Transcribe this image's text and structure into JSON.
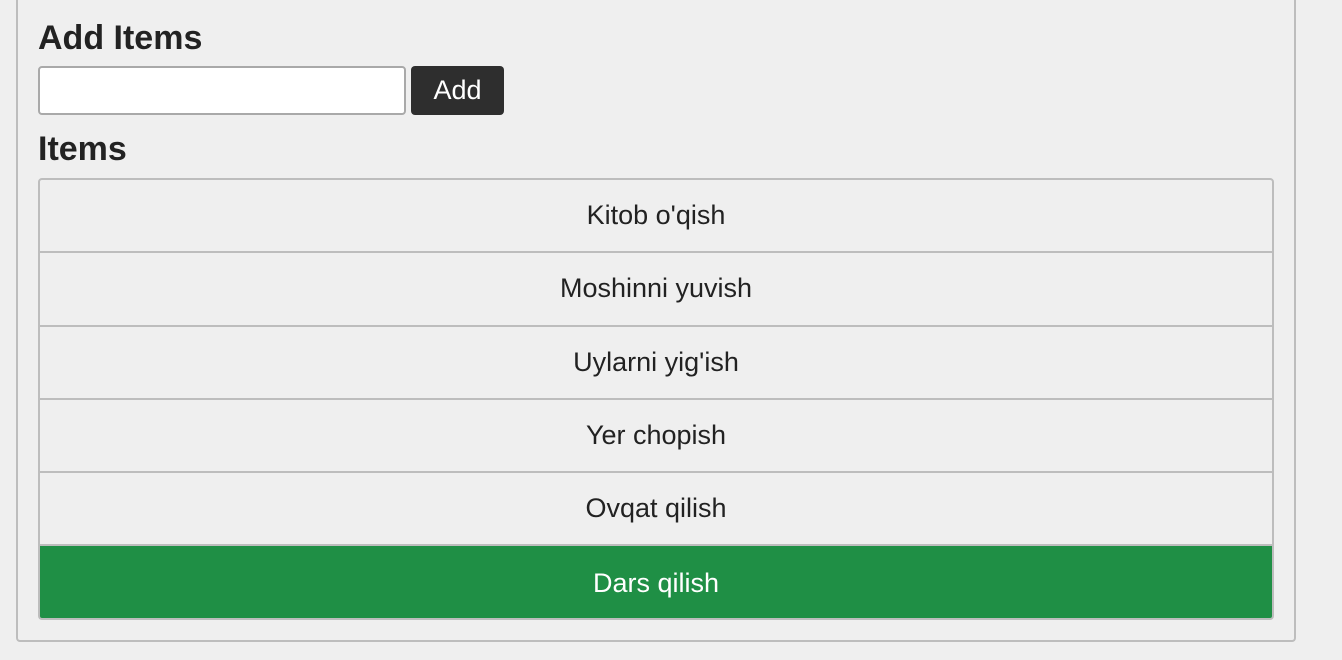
{
  "add_section": {
    "heading": "Add Items",
    "input_value": "",
    "input_placeholder": "",
    "button_label": "Add"
  },
  "items_section": {
    "heading": "Items",
    "items": [
      {
        "label": "Kitob o'qish",
        "active": false
      },
      {
        "label": "Moshinni yuvish",
        "active": false
      },
      {
        "label": "Uylarni yig'ish",
        "active": false
      },
      {
        "label": "Yer chopish",
        "active": false
      },
      {
        "label": "Ovqat qilish",
        "active": false
      },
      {
        "label": "Dars qilish",
        "active": true
      }
    ]
  },
  "colors": {
    "background": "#efefef",
    "button_bg": "#2e2e2e",
    "active_item_bg": "#1f8f45",
    "border": "#bdbdbd"
  }
}
